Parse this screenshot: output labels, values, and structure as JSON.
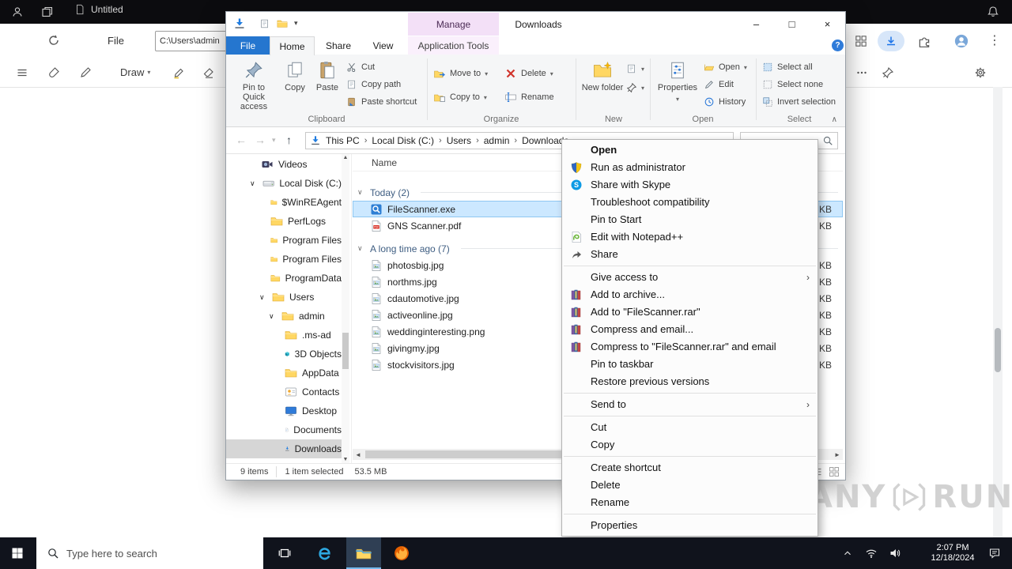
{
  "glyphs": {
    "dropdown": "▾",
    "chevron_down": "∨",
    "chevron_right": "›",
    "back": "←",
    "forward": "→",
    "up": "↑",
    "minimize": "–",
    "maximize": "□",
    "close": "×",
    "collapse": "∧",
    "dots_vertical": "⋮",
    "scroll_up": "▲",
    "scroll_down": "▼",
    "scroll_left": "◄",
    "scroll_right": "►",
    "help": "?"
  },
  "host": {
    "tab_title": "Untitled",
    "file_label": "File",
    "address_value": "C:\\Users\\admin",
    "draw_label": "Draw"
  },
  "explorer": {
    "title": "Downloads",
    "manage_label": "Manage",
    "tabs": {
      "file": "File",
      "home": "Home",
      "share": "Share",
      "view": "View",
      "app_tools": "Application Tools"
    },
    "ribbon": {
      "pin": "Pin to Quick access",
      "copy": "Copy",
      "paste": "Paste",
      "cut": "Cut",
      "copy_path": "Copy path",
      "paste_shortcut": "Paste shortcut",
      "move_to": "Move to",
      "copy_to": "Copy to",
      "del": "Delete",
      "rename": "Rename",
      "new_folder": "New folder",
      "properties": "Properties",
      "open": "Open",
      "edit": "Edit",
      "history": "History",
      "select_all": "Select all",
      "select_none": "Select none",
      "invert_selection": "Invert selection",
      "groups": {
        "clipboard": "Clipboard",
        "organize": "Organize",
        "new": "New",
        "open": "Open",
        "select": "Select"
      }
    },
    "address": {
      "crumbs": [
        "This PC",
        "Local Disk (C:)",
        "Users",
        "admin",
        "Downloads"
      ]
    },
    "nav": {
      "items": [
        {
          "label": "Videos",
          "icon": "videos"
        },
        {
          "label": "Local Disk (C:)",
          "icon": "drive"
        },
        {
          "label": "$WinREAgent",
          "icon": "folder"
        },
        {
          "label": "PerfLogs",
          "icon": "folder"
        },
        {
          "label": "Program Files",
          "icon": "folder"
        },
        {
          "label": "Program Files",
          "icon": "folder"
        },
        {
          "label": "ProgramData",
          "icon": "folder"
        },
        {
          "label": "Users",
          "icon": "folder"
        },
        {
          "label": "admin",
          "icon": "folder"
        },
        {
          "label": ".ms-ad",
          "icon": "folder"
        },
        {
          "label": "3D Objects",
          "icon": "3d-objects"
        },
        {
          "label": "AppData",
          "icon": "folder"
        },
        {
          "label": "Contacts",
          "icon": "contacts"
        },
        {
          "label": "Desktop",
          "icon": "desktop"
        },
        {
          "label": "Documents",
          "icon": "documents"
        },
        {
          "label": "Downloads",
          "icon": "downloads",
          "selected": true
        }
      ]
    },
    "files": {
      "name_header": "Name",
      "groups": [
        {
          "label": "Today (2)",
          "rows": [
            {
              "name": "FileScanner.exe",
              "icon": "exe",
              "size": "KB",
              "selected": true
            },
            {
              "name": "GNS Scanner.pdf",
              "icon": "pdf",
              "size": "KB"
            }
          ]
        },
        {
          "label": "A long time ago (7)",
          "rows": [
            {
              "name": "photosbig.jpg",
              "icon": "image",
              "size": "KB"
            },
            {
              "name": "northms.jpg",
              "icon": "image",
              "size": "KB"
            },
            {
              "name": "cdautomotive.jpg",
              "icon": "image",
              "size": "KB"
            },
            {
              "name": "activeonline.jpg",
              "icon": "image",
              "size": "KB"
            },
            {
              "name": "weddinginteresting.png",
              "icon": "image",
              "size": "KB"
            },
            {
              "name": "givingmy.jpg",
              "icon": "image",
              "size": "KB"
            },
            {
              "name": "stockvisitors.jpg",
              "icon": "image",
              "size": "KB"
            }
          ]
        }
      ]
    },
    "status": {
      "count": "9 items",
      "selected": "1 item selected",
      "size": "53.5 MB"
    }
  },
  "context_menu": {
    "items": [
      {
        "label": "Open",
        "bold": true
      },
      {
        "label": "Run as administrator",
        "icon": "uac-shield"
      },
      {
        "label": "Share with Skype",
        "icon": "skype"
      },
      {
        "label": "Troubleshoot compatibility"
      },
      {
        "label": "Pin to Start"
      },
      {
        "label": "Edit with Notepad++",
        "icon": "notepad-plus-plus"
      },
      {
        "label": "Share",
        "icon": "share"
      },
      {
        "separator": true
      },
      {
        "label": "Give access to",
        "submenu": true
      },
      {
        "label": "Add to archive...",
        "icon": "winrar"
      },
      {
        "label": "Add to \"FileScanner.rar\"",
        "icon": "winrar"
      },
      {
        "label": "Compress and email...",
        "icon": "winrar"
      },
      {
        "label": "Compress to \"FileScanner.rar\" and email",
        "icon": "winrar"
      },
      {
        "label": "Pin to taskbar"
      },
      {
        "label": "Restore previous versions"
      },
      {
        "separator": true
      },
      {
        "label": "Send to",
        "submenu": true
      },
      {
        "separator": true
      },
      {
        "label": "Cut"
      },
      {
        "label": "Copy"
      },
      {
        "separator": true
      },
      {
        "label": "Create shortcut"
      },
      {
        "label": "Delete"
      },
      {
        "label": "Rename"
      },
      {
        "separator": true
      },
      {
        "label": "Properties"
      }
    ]
  },
  "taskbar": {
    "search_placeholder": "Type here to search",
    "time": "2:07 PM",
    "date": "12/18/2024"
  },
  "watermark": {
    "left": "ANY",
    "right": "RUN"
  },
  "colors": {
    "accent_blue": "#2576cf",
    "selection_blue": "#cce8ff",
    "manage_lavender": "#f3e0f7",
    "taskbar_dark": "#10131c"
  }
}
